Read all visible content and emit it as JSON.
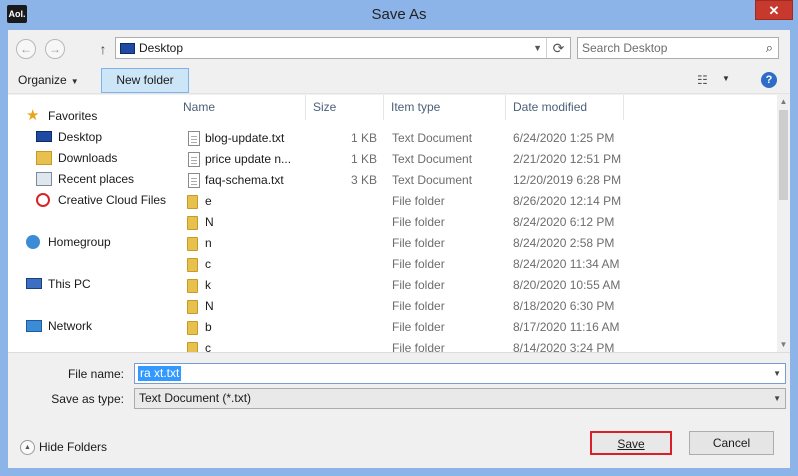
{
  "window": {
    "title": "Save As",
    "app_icon_text": "Aol.",
    "close_glyph": "✕"
  },
  "address": {
    "back_glyph": "←",
    "forward_glyph": "→",
    "up_glyph": "↑",
    "location": "Desktop",
    "refresh_glyph": "⟳",
    "search_placeholder": "Search Desktop",
    "search_glyph": "⌕"
  },
  "toolbar": {
    "organize_label": "Organize",
    "new_folder_label": "New folder",
    "view_glyph": "☷",
    "help_glyph": "?"
  },
  "nav": {
    "favorites": "Favorites",
    "desktop": "Desktop",
    "downloads": "Downloads",
    "recent_places": "Recent places",
    "creative_cloud": "Creative Cloud Files",
    "homegroup": "Homegroup",
    "this_pc": "This PC",
    "network": "Network"
  },
  "columns": {
    "name": "Name",
    "size": "Size",
    "type": "Item type",
    "date": "Date modified"
  },
  "files": [
    {
      "name": "blog-update.txt",
      "size": "1 KB",
      "type": "Text Document",
      "date": "6/24/2020 1:25 PM",
      "kind": "file"
    },
    {
      "name": "price update n...",
      "size": "1 KB",
      "type": "Text Document",
      "date": "2/21/2020 12:51 PM",
      "kind": "file"
    },
    {
      "name": "faq-schema.txt",
      "size": "3 KB",
      "type": "Text Document",
      "date": "12/20/2019 6:28 PM",
      "kind": "file"
    },
    {
      "name": "e",
      "size": "",
      "type": "File folder",
      "date": "8/26/2020 12:14 PM",
      "kind": "folder"
    },
    {
      "name": "N",
      "size": "",
      "type": "File folder",
      "date": "8/24/2020 6:12 PM",
      "kind": "folder"
    },
    {
      "name": "n",
      "size": "",
      "type": "File folder",
      "date": "8/24/2020 2:58 PM",
      "kind": "folder"
    },
    {
      "name": "c",
      "size": "",
      "type": "File folder",
      "date": "8/24/2020 11:34 AM",
      "kind": "folder"
    },
    {
      "name": "k",
      "size": "",
      "type": "File folder",
      "date": "8/20/2020 10:55 AM",
      "kind": "folder"
    },
    {
      "name": "N",
      "size": "",
      "type": "File folder",
      "date": "8/18/2020 6:30 PM",
      "kind": "folder"
    },
    {
      "name": "b",
      "size": "",
      "type": "File folder",
      "date": "8/17/2020 11:16 AM",
      "kind": "folder"
    },
    {
      "name": "c",
      "size": "",
      "type": "File folder",
      "date": "8/14/2020 3:24 PM",
      "kind": "folder"
    }
  ],
  "form": {
    "filename_label": "File name:",
    "filename_value": "ra          xt.txt",
    "savetype_label": "Save as type:",
    "savetype_value": "Text Document (*.txt)"
  },
  "footer": {
    "hide_folders_label": "Hide Folders",
    "save_label": "Save",
    "cancel_label": "Cancel"
  },
  "colors": {
    "title_bar": "#8cb4e8",
    "selection": "#3399ff",
    "save_highlight": "#d8202a"
  }
}
